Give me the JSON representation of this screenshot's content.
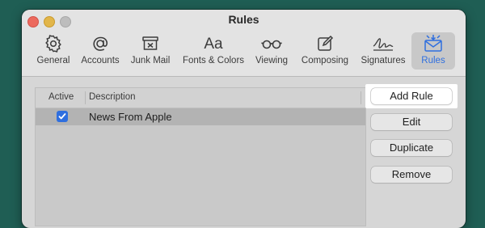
{
  "window": {
    "title": "Rules"
  },
  "toolbar": {
    "items": [
      {
        "label": "General",
        "icon": "gear-icon"
      },
      {
        "label": "Accounts",
        "icon": "at-sign-icon"
      },
      {
        "label": "Junk Mail",
        "icon": "junk-box-icon"
      },
      {
        "label": "Fonts & Colors",
        "icon": "font-icon",
        "glyph": "Aa"
      },
      {
        "label": "Viewing",
        "icon": "glasses-icon"
      },
      {
        "label": "Composing",
        "icon": "compose-icon"
      },
      {
        "label": "Signatures",
        "icon": "signature-icon"
      },
      {
        "label": "Rules",
        "icon": "rules-envelope-icon",
        "selected": true
      }
    ]
  },
  "rules_table": {
    "columns": [
      "Active",
      "Description"
    ],
    "rows": [
      {
        "active": true,
        "description": "News From Apple",
        "selected": true
      }
    ]
  },
  "buttons": {
    "add_rule": "Add Rule",
    "edit": "Edit",
    "duplicate": "Duplicate",
    "remove": "Remove"
  },
  "colors": {
    "accent": "#2f6fdf",
    "desktop": "#1f5e54"
  }
}
